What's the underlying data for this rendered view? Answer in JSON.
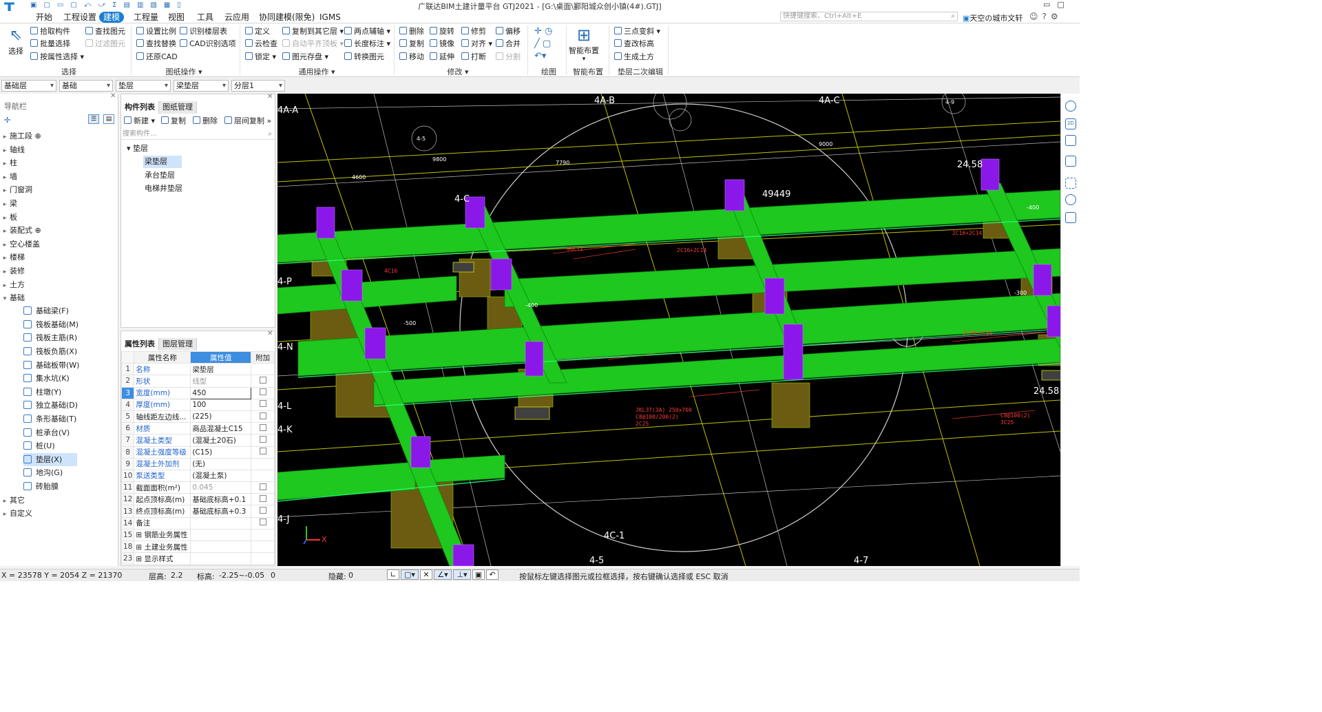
{
  "window": {
    "title": "广联达BIM土建计量平台 GTJ2021 - [G:\\桌面\\鄞阳城众创小镇(4#).GTJ]",
    "search_placeholder": "快捷键搜索、Ctrl+Alt+E",
    "user": "天空の城市文轩"
  },
  "menu": {
    "tabs": [
      "开始",
      "工程设置",
      "建模",
      "工程量",
      "视图",
      "工具",
      "云应用",
      "协同建模(限免)",
      "IGMS"
    ],
    "active": "建模"
  },
  "ribbon": {
    "select_label": "选择",
    "select_items": [
      "拾取构件",
      "批量选择",
      "按属性选择"
    ],
    "find_items": [
      "查找图元",
      "过滤图元"
    ],
    "group_select": "选择",
    "drawing_ops": [
      "设置比例",
      "识别楼层表",
      "查找替换",
      "CAD识别选项",
      "还原CAD"
    ],
    "group_drawing": "图纸操作",
    "common_ops": [
      "定义",
      "复制到其它层",
      "两点辅轴",
      "云检查",
      "自动平齐顶板",
      "长度标注",
      "锁定",
      "图元存盘",
      "转换图元"
    ],
    "group_common": "通用操作",
    "modify_ops": [
      "删除",
      "旋转",
      "修剪",
      "偏移",
      "复制",
      "镜像",
      "对齐",
      "合并",
      "移动",
      "延伸",
      "打断",
      "分割"
    ],
    "group_modify": "修改",
    "group_draw": "绘图",
    "smart_layout": "智能布置",
    "group_smart": "智能布置",
    "secondary_ops": [
      "三点变斜",
      "查改标高",
      "生成土方"
    ],
    "group_secondary": "垫层二次编辑"
  },
  "filters": [
    "基础层",
    "基础",
    "垫层",
    "梁垫层",
    "分层1"
  ],
  "nav": {
    "title": "导航栏",
    "items": [
      "施工段",
      "轴线",
      "柱",
      "墙",
      "门窗洞",
      "梁",
      "板",
      "装配式",
      "空心楼盖",
      "楼梯",
      "装修",
      "土方",
      "基础"
    ],
    "foundation_children": [
      "基础梁(F)",
      "筏板基础(M)",
      "筏板主筋(R)",
      "筏板负筋(X)",
      "基础板带(W)",
      "集水坑(K)",
      "柱墩(Y)",
      "独立基础(D)",
      "条形基础(T)",
      "桩承台(V)",
      "桩(U)",
      "垫层(X)",
      "地沟(G)",
      "砖胎膜"
    ],
    "selected_child": "垫层(X)",
    "after": [
      "其它",
      "自定义"
    ]
  },
  "complist": {
    "tabs": [
      "构件列表",
      "图纸管理"
    ],
    "toolbar": [
      "新建",
      "复制",
      "删除",
      "层间复制"
    ],
    "search_placeholder": "搜索构件...",
    "group": "垫层",
    "items": [
      "梁垫层",
      "承台垫层",
      "电梯井垫层"
    ],
    "selected": "梁垫层"
  },
  "props": {
    "tabs": [
      "属性列表",
      "图层管理"
    ],
    "headers": [
      "属性名称",
      "属性值",
      "附加"
    ],
    "rows": [
      {
        "n": "1",
        "k": "名称",
        "v": "梁垫层",
        "blue": true,
        "cb": false
      },
      {
        "n": "2",
        "k": "形状",
        "v": "线型",
        "blue": true,
        "cb": true,
        "gray": true
      },
      {
        "n": "3",
        "k": "宽度(mm)",
        "v": "450",
        "blue": true,
        "cb": true
      },
      {
        "n": "4",
        "k": "厚度(mm)",
        "v": "100",
        "blue": true,
        "cb": true
      },
      {
        "n": "5",
        "k": "轴线距左边线...",
        "v": "(225)",
        "blue": false,
        "cb": true
      },
      {
        "n": "6",
        "k": "材质",
        "v": "商品混凝土C15",
        "blue": true,
        "cb": true
      },
      {
        "n": "7",
        "k": "混凝土类型",
        "v": "(混凝土20石)",
        "blue": true,
        "cb": true
      },
      {
        "n": "8",
        "k": "混凝土强度等级",
        "v": "(C15)",
        "blue": true,
        "cb": true
      },
      {
        "n": "9",
        "k": "混凝土外加剂",
        "v": "(无)",
        "blue": true,
        "cb": false
      },
      {
        "n": "10",
        "k": "泵送类型",
        "v": "(混凝土泵)",
        "blue": true,
        "cb": false
      },
      {
        "n": "11",
        "k": "截面面积(m²)",
        "v": "0.045",
        "blue": false,
        "cb": true,
        "gray": true
      },
      {
        "n": "12",
        "k": "起点顶标高(m)",
        "v": "基础底标高+0.1",
        "blue": false,
        "cb": true
      },
      {
        "n": "13",
        "k": "终点顶标高(m)",
        "v": "基础底标高+0.3",
        "blue": false,
        "cb": true
      },
      {
        "n": "14",
        "k": "备注",
        "v": "",
        "blue": false,
        "cb": true
      },
      {
        "n": "15",
        "k": "⊞ 钢筋业务属性",
        "v": "",
        "blue": false,
        "cb": false
      },
      {
        "n": "18",
        "k": "⊞ 土建业务属性",
        "v": "",
        "blue": false,
        "cb": false
      },
      {
        "n": "23",
        "k": "⊞ 显示样式",
        "v": "",
        "blue": false,
        "cb": false
      }
    ],
    "selected_row": "3"
  },
  "viewport": {
    "axis_labels": [
      "4A-A",
      "4A-B",
      "4A-C",
      "4-P",
      "4-N",
      "4-L",
      "4-K",
      "4-J",
      "4C-1",
      "4-5",
      "4-7",
      "4-9",
      "4-C",
      "4-5"
    ],
    "dims": [
      "49449",
      "24.58",
      "24.58",
      "-400",
      "-400",
      "-500",
      "-300",
      "7790",
      "9800",
      "4600",
      "9000"
    ],
    "annotations": [
      "2C16+2C14",
      "2C16+2C14",
      "JKL37(3A) 250x700",
      "C8@100/200(2)",
      "2C25",
      "G6C12",
      "4C16",
      "2C20+2C16",
      "C8@100(2)",
      "3C25"
    ]
  },
  "status": {
    "coords": "X = 23578 Y = 2054 Z = 21370",
    "floor_height_label": "层高:",
    "floor_height": "2.2",
    "elevation_label": "标高:",
    "elevation": "-2.25~-0.05",
    "zero": "0",
    "hidden_label": "隐藏:",
    "hidden": "0",
    "hint": "按鼠标左键选择图元或拉框选择，按右键确认选择或 ESC 取消"
  },
  "colors": {
    "accent": "#1a7fd1",
    "beam": "#1ec81e",
    "column": "#8a18e8",
    "pedestal": "#6a5a10",
    "viewport_bg": "#000000"
  }
}
